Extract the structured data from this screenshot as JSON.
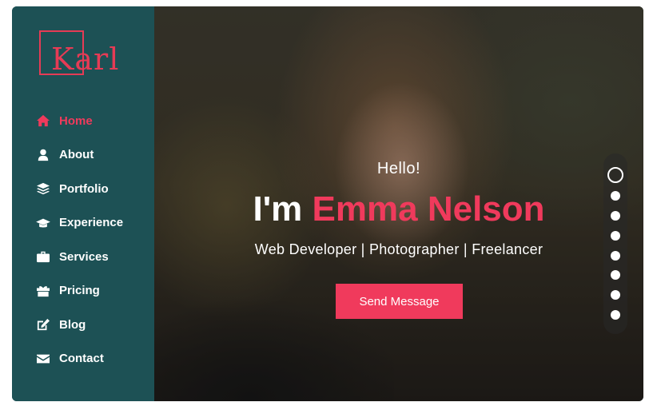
{
  "logo": {
    "text": "Karl"
  },
  "nav": [
    {
      "label": "Home",
      "icon": "home-icon",
      "active": true
    },
    {
      "label": "About",
      "icon": "user-icon",
      "active": false
    },
    {
      "label": "Portfolio",
      "icon": "layers-icon",
      "active": false
    },
    {
      "label": "Experience",
      "icon": "graduation-cap-icon",
      "active": false
    },
    {
      "label": "Services",
      "icon": "briefcase-icon",
      "active": false
    },
    {
      "label": "Pricing",
      "icon": "gift-icon",
      "active": false
    },
    {
      "label": "Blog",
      "icon": "edit-icon",
      "active": false
    },
    {
      "label": "Contact",
      "icon": "envelope-icon",
      "active": false
    }
  ],
  "hero": {
    "greeting": "Hello!",
    "name_prefix": "I'm",
    "name": "Emma Nelson",
    "roles": "Web Developer | Photographer | Freelancer",
    "cta_label": "Send Message"
  },
  "slider": {
    "count": 8,
    "active_index": 0
  },
  "colors": {
    "accent": "#f03a5c",
    "sidebar": "#1d5155",
    "text": "#ffffff"
  }
}
